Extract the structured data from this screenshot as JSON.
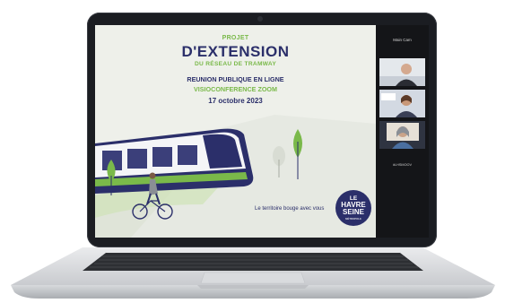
{
  "slide": {
    "projet": "PROJET",
    "extension": "D'EXTENSION",
    "du_reseau": "DU RÉSEAU DE TRAMWAY",
    "reunion": "REUNION PUBLIQUE EN LIGNE",
    "visio": "VISIOCONFERENCE ZOOM",
    "date": "17 octobre 2023",
    "tagline": "Le territoire bouge avec vous",
    "logo": {
      "line1": "LE",
      "line2": "HAVRE",
      "line3": "SEINE",
      "line4": "MÉTROPOLE"
    }
  },
  "zoom_panel": {
    "title": "Main Cam",
    "hashtag": "#LHSMOOV"
  },
  "colors": {
    "navy": "#2b2f6a",
    "green": "#7ab94a",
    "slide_bg": "#eef0ea",
    "panel_bg": "#141518"
  }
}
